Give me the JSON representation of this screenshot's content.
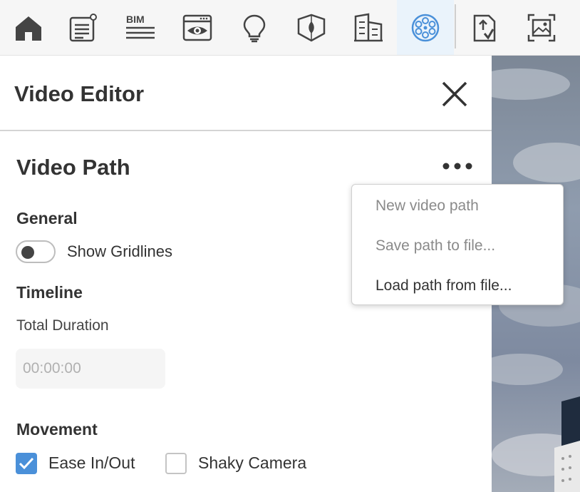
{
  "toolbar": {
    "items": [
      {
        "icon": "home-icon"
      },
      {
        "icon": "notes-icon"
      },
      {
        "icon": "bim-icon",
        "text": "BIM"
      },
      {
        "icon": "view-icon"
      },
      {
        "icon": "lightbulb-icon"
      },
      {
        "icon": "landscape-icon"
      },
      {
        "icon": "buildings-icon"
      },
      {
        "icon": "video-reel-icon",
        "active": true
      },
      {
        "icon": "export-icon"
      },
      {
        "icon": "image-icon"
      }
    ]
  },
  "panel": {
    "title": "Video Editor",
    "section_title": "Video Path",
    "general": {
      "label": "General",
      "show_gridlines_label": "Show Gridlines",
      "show_gridlines_on": false
    },
    "timeline": {
      "label": "Timeline",
      "total_duration_label": "Total Duration",
      "total_duration_placeholder": "00:00:00"
    },
    "movement": {
      "label": "Movement",
      "ease_label": "Ease In/Out",
      "ease_checked": true,
      "shaky_label": "Shaky Camera",
      "shaky_checked": false
    }
  },
  "menu": {
    "items": [
      {
        "label": "New video path",
        "enabled": false
      },
      {
        "label": "Save path to file...",
        "enabled": false
      },
      {
        "label": "Load path from file...",
        "enabled": true
      }
    ]
  },
  "colors": {
    "accent": "#4a90d9",
    "icon_default": "#444444",
    "icon_active": "#4a90d9",
    "toolbar_bg": "#f6f6f6"
  }
}
